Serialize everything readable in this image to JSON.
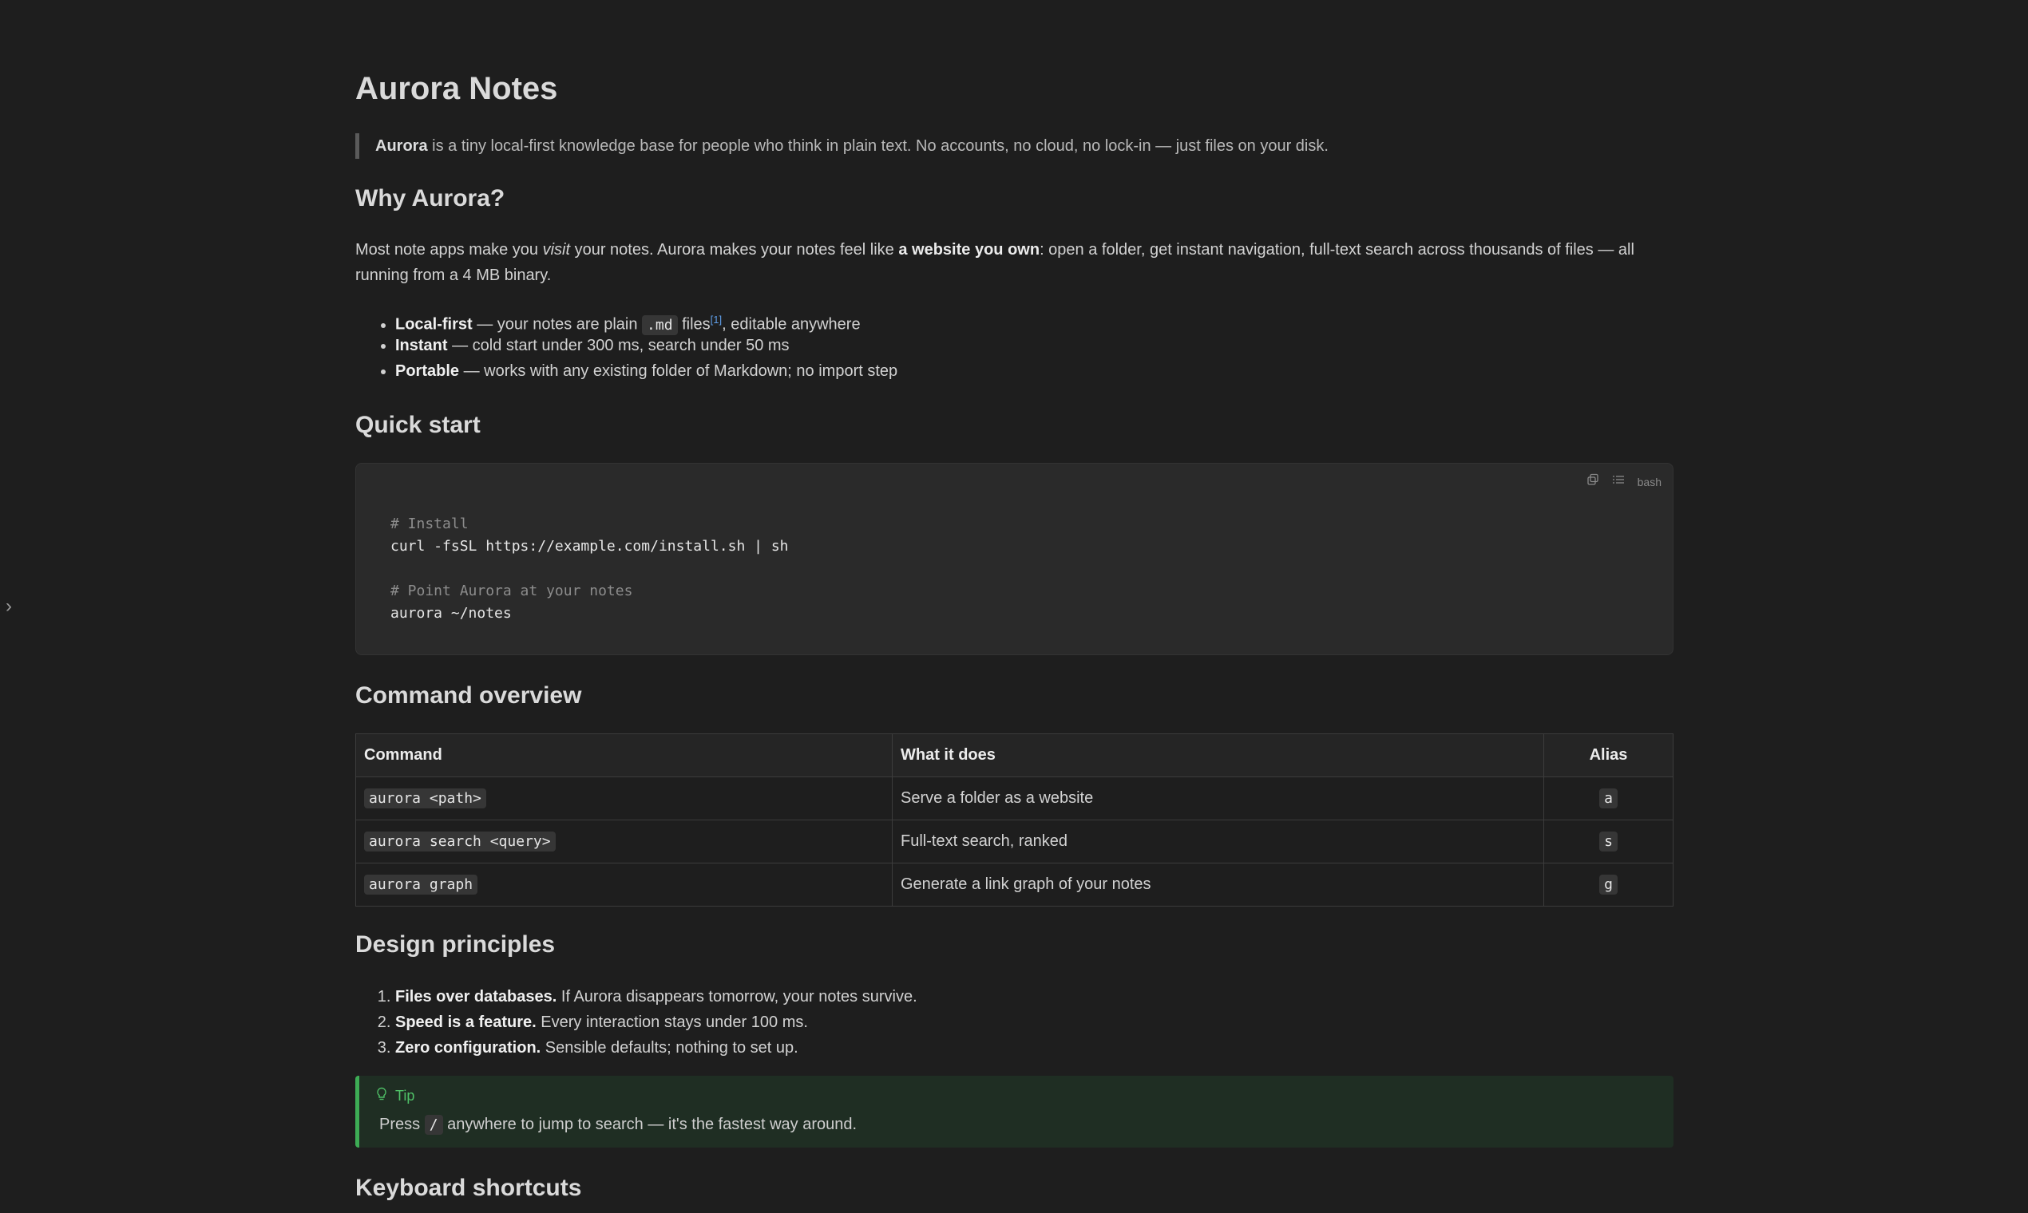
{
  "sidebar": {
    "toggle_glyph": "›",
    "toggle_icon": "chevron-right-icon"
  },
  "title": "Aurora Notes",
  "lead": {
    "bold": "Aurora",
    "rest": " is a tiny local-first knowledge base for people who think in plain text. No accounts, no cloud, no lock-in — just files on your disk."
  },
  "why": {
    "heading": "Why Aurora?",
    "para": {
      "p1": "Most note apps make you ",
      "em": "visit",
      "p2": " your notes. Aurora makes your notes feel like ",
      "strong": "a website you own",
      "p3": ": open a folder, get instant navigation, full-text search across thousands of files — all running from a 4 MB binary."
    },
    "bullets": [
      {
        "term": "Local-first",
        "pre": " — your notes are plain ",
        "code": ".md",
        "mid": " files",
        "fn": "[1]",
        "post": ", editable anywhere"
      },
      {
        "term": "Instant",
        "text": " — cold start under 300 ms, search under 50 ms"
      },
      {
        "term": "Portable",
        "text": " — works with any existing folder of Markdown; no import step"
      }
    ]
  },
  "quickstart": {
    "heading": "Quick start",
    "toolbar": {
      "copy_icon": "copy-icon",
      "wrap_icon": "wrap-lines-icon",
      "lang": "bash"
    },
    "lines": [
      {
        "text": "# Install",
        "kind": "cmt"
      },
      {
        "text": "curl -fsSL https://example.com/install.sh | sh",
        "kind": "code"
      },
      {
        "text": "",
        "kind": "code"
      },
      {
        "text": "# Point Aurora at your notes",
        "kind": "cmt"
      },
      {
        "text": "aurora ~/notes",
        "kind": "code"
      }
    ]
  },
  "commands": {
    "heading": "Command overview",
    "headers": [
      "Command",
      "What it does",
      "Alias"
    ],
    "rows": [
      {
        "command": "aurora <path>",
        "desc": "Serve a folder as a website",
        "alias": "a"
      },
      {
        "command": "aurora search <query>",
        "desc": "Full-text search, ranked",
        "alias": "s"
      },
      {
        "command": "aurora graph",
        "desc": "Generate a link graph of your notes",
        "alias": "g"
      }
    ]
  },
  "principles": {
    "heading": "Design principles",
    "items": [
      {
        "term": "Files over databases.",
        "text": " If Aurora disappears tomorrow, your notes survive."
      },
      {
        "term": "Speed is a feature.",
        "text": " Every interaction stays under 100 ms."
      },
      {
        "term": "Zero configuration.",
        "text": " Sensible defaults; nothing to set up."
      }
    ]
  },
  "tip": {
    "icon": "lightbulb-icon",
    "title": "Tip",
    "pre": "Press ",
    "key": "/",
    "post": " anywhere to jump to search — it's the fastest way around."
  },
  "shortcuts": {
    "heading": "Keyboard shortcuts"
  },
  "colors": {
    "background": "#1e1e1e",
    "tip_accent": "#3dac55",
    "link": "#5f9ee8"
  }
}
